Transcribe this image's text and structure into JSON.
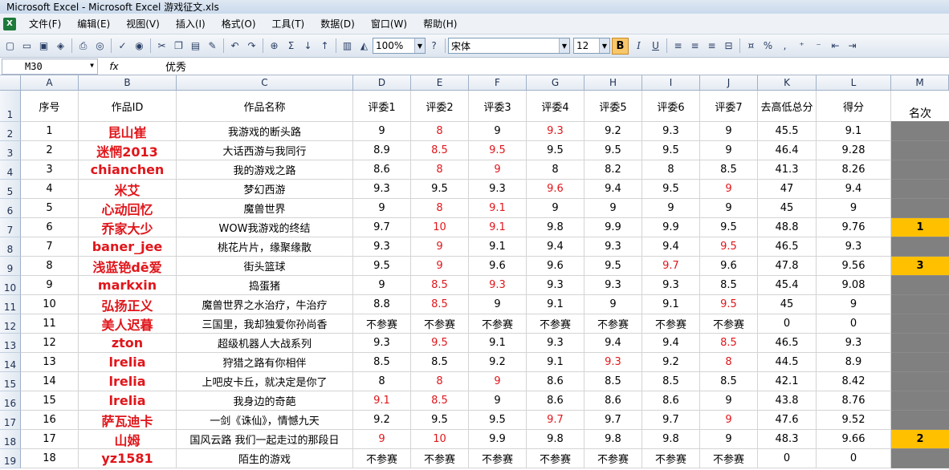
{
  "window": {
    "title": "Microsoft Excel - Microsoft Excel  游戏征文.xls"
  },
  "menu": [
    "文件(F)",
    "编辑(E)",
    "视图(V)",
    "插入(I)",
    "格式(O)",
    "工具(T)",
    "数据(D)",
    "窗口(W)",
    "帮助(H)"
  ],
  "toolbar": {
    "zoom": "100%",
    "font": "宋体",
    "size": "12",
    "bold": "B",
    "italic": "I",
    "underline": "U"
  },
  "formula": {
    "cell_ref": "M30",
    "fx": "fx",
    "value": "优秀"
  },
  "columns": [
    "A",
    "B",
    "C",
    "D",
    "E",
    "F",
    "G",
    "H",
    "I",
    "J",
    "K",
    "L",
    "M"
  ],
  "header_row": [
    "序号",
    "作品ID",
    "作品名称",
    "评委1",
    "评委2",
    "评委3",
    "评委4",
    "评委5",
    "评委6",
    "评委7",
    "去高低总分",
    "得分",
    "名次"
  ],
  "rows": [
    {
      "n": "2",
      "cells": [
        "1",
        "昆山崔",
        "我游戏的断头路",
        "9",
        "8",
        "9",
        "9.3",
        "9.2",
        "9.3",
        "9",
        "45.5",
        "9.1",
        ""
      ],
      "red": [
        4,
        6
      ]
    },
    {
      "n": "3",
      "cells": [
        "2",
        "迷惘2013",
        "大话西游与我同行",
        "8.9",
        "8.5",
        "9.5",
        "9.5",
        "9.5",
        "9.5",
        "9",
        "46.4",
        "9.28",
        ""
      ],
      "red": [
        4,
        5
      ]
    },
    {
      "n": "4",
      "cells": [
        "3",
        "chianchen",
        "我的游戏之路",
        "8.6",
        "8",
        "9",
        "8",
        "8.2",
        "8",
        "8.5",
        "41.3",
        "8.26",
        ""
      ],
      "red": [
        4,
        5
      ]
    },
    {
      "n": "5",
      "cells": [
        "4",
        "米艾",
        "梦幻西游",
        "9.3",
        "9.5",
        "9.3",
        "9.6",
        "9.4",
        "9.5",
        "9",
        "47",
        "9.4",
        ""
      ],
      "red": [
        6,
        9
      ]
    },
    {
      "n": "6",
      "cells": [
        "5",
        "心动回忆",
        "魔兽世界",
        "9",
        "8",
        "9.1",
        "9",
        "9",
        "9",
        "9",
        "45",
        "9",
        ""
      ],
      "red": [
        4,
        5
      ]
    },
    {
      "n": "7",
      "cells": [
        "6",
        "乔家大少",
        "WOW我游戏的终结",
        "9.7",
        "10",
        "9.1",
        "9.8",
        "9.9",
        "9.9",
        "9.5",
        "48.8",
        "9.76",
        "1"
      ],
      "red": [
        4,
        5
      ]
    },
    {
      "n": "8",
      "cells": [
        "7",
        "baner_jee",
        "桃花片片，缘聚缘散",
        "9.3",
        "9",
        "9.1",
        "9.4",
        "9.3",
        "9.4",
        "9.5",
        "46.5",
        "9.3",
        ""
      ],
      "red": [
        4,
        9
      ]
    },
    {
      "n": "9",
      "cells": [
        "8",
        "浅蓝铯dē爱",
        "街头篮球",
        "9.5",
        "9",
        "9.6",
        "9.6",
        "9.5",
        "9.7",
        "9.6",
        "47.8",
        "9.56",
        "3"
      ],
      "red": [
        4,
        8
      ]
    },
    {
      "n": "10",
      "cells": [
        "9",
        "markxin",
        "捣蛋猪",
        "9",
        "8.5",
        "9.3",
        "9.3",
        "9.3",
        "9.3",
        "8.5",
        "45.4",
        "9.08",
        ""
      ],
      "red": [
        4,
        5
      ]
    },
    {
      "n": "11",
      "cells": [
        "10",
        "弘扬正义",
        "魔兽世界之水治疗，牛治疗",
        "8.8",
        "8.5",
        "9",
        "9.1",
        "9",
        "9.1",
        "9.5",
        "45",
        "9",
        ""
      ],
      "red": [
        4,
        9
      ]
    },
    {
      "n": "12",
      "cells": [
        "11",
        "美人迟暮",
        "三国里，我却独爱你孙尚香",
        "不参赛",
        "不参赛",
        "不参赛",
        "不参赛",
        "不参赛",
        "不参赛",
        "不参赛",
        "0",
        "0",
        ""
      ],
      "red": []
    },
    {
      "n": "13",
      "cells": [
        "12",
        "zton",
        "超级机器人大战系列",
        "9.3",
        "9.5",
        "9.1",
        "9.3",
        "9.4",
        "9.4",
        "8.5",
        "46.5",
        "9.3",
        ""
      ],
      "red": [
        4,
        9
      ]
    },
    {
      "n": "14",
      "cells": [
        "13",
        "lrelia",
        "狩猎之路有你相伴",
        "8.5",
        "8.5",
        "9.2",
        "9.1",
        "9.3",
        "9.2",
        "8",
        "44.5",
        "8.9",
        ""
      ],
      "red": [
        7,
        9
      ]
    },
    {
      "n": "15",
      "cells": [
        "14",
        "lrelia",
        "上吧皮卡丘，就决定是你了",
        "8",
        "8",
        "9",
        "8.6",
        "8.5",
        "8.5",
        "8.5",
        "42.1",
        "8.42",
        ""
      ],
      "red": [
        4,
        5
      ]
    },
    {
      "n": "16",
      "cells": [
        "15",
        "lrelia",
        "我身边的奇葩",
        "9.1",
        "8.5",
        "9",
        "8.6",
        "8.6",
        "8.6",
        "9",
        "43.8",
        "8.76",
        ""
      ],
      "red": [
        3,
        4
      ]
    },
    {
      "n": "17",
      "cells": [
        "16",
        "萨瓦迪卡",
        "一剑《诛仙》，情憾九天",
        "9.2",
        "9.5",
        "9.5",
        "9.7",
        "9.7",
        "9.7",
        "9",
        "47.6",
        "9.52",
        ""
      ],
      "red": [
        6,
        9
      ]
    },
    {
      "n": "18",
      "cells": [
        "17",
        "山姆",
        "国风云路 我们一起走过的那段日",
        "9",
        "10",
        "9.9",
        "9.8",
        "9.8",
        "9.8",
        "9",
        "48.3",
        "9.66",
        "2"
      ],
      "red": [
        3,
        4
      ]
    },
    {
      "n": "19",
      "cells": [
        "18",
        "yz1581",
        "陌生的游戏",
        "不参赛",
        "不参赛",
        "不参赛",
        "不参赛",
        "不参赛",
        "不参赛",
        "不参赛",
        "0",
        "0",
        ""
      ],
      "red": []
    }
  ],
  "colors": {
    "red_text": "#e0161b",
    "rank_gold": "#ffc000",
    "rank_gray": "#808080"
  }
}
